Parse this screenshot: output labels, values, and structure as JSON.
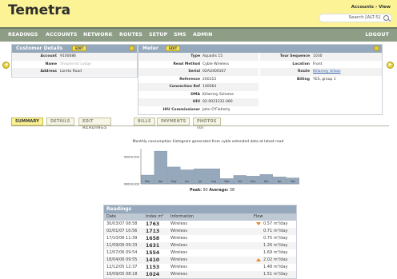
{
  "app": {
    "title": "Temetra",
    "breadcrumb": "Accounts › View",
    "search_placeholder": "Search [ALT-S]"
  },
  "nav": {
    "items": [
      "READINGS",
      "ACCOUNTS",
      "NETWORK",
      "ROUTES",
      "SETUP",
      "SMS",
      "ADMIN"
    ],
    "logout": "LOGOUT"
  },
  "customer": {
    "title": "Customer Details",
    "edit": "EDIT",
    "fields": [
      {
        "label": "Account",
        "value": "9100086"
      },
      {
        "label": "Name",
        "value": "Shepherds Lodge"
      },
      {
        "label": "Address",
        "value": "Loreto Road"
      }
    ]
  },
  "meter": {
    "title": "Meter",
    "edit": "EDIT",
    "fields": [
      {
        "label": "Type",
        "value": "Aquadis 15"
      },
      {
        "label": "Read Method",
        "value": "Cyble Wireless"
      },
      {
        "label": "Serial",
        "value": "02AU400167"
      },
      {
        "label": "Reference",
        "value": "200315"
      },
      {
        "label": "Connection Ref",
        "value": "100064"
      },
      {
        "label": "DMA",
        "value": "Killarney Scheme"
      },
      {
        "label": "HIU",
        "value": "02-0021332-060"
      },
      {
        "label": "HIU Commissioner",
        "value": "John O'Flaherty"
      }
    ],
    "extra": [
      {
        "label": "Tour Sequence",
        "value": "1030"
      },
      {
        "label": "Location",
        "value": "Front"
      },
      {
        "label": "Route",
        "value": "Killarney Urban"
      },
      {
        "label": "Billing",
        "value": "YES, group 1"
      }
    ]
  },
  "tabs": [
    "SUMMARY",
    "DETAILS",
    "EDIT READINGS",
    "BILLS",
    "PAYMENTS",
    "PHOTOS (0)"
  ],
  "chart_caption": "Monthly consumption histogram generated from cyble extended data at latest read",
  "chart_data": {
    "type": "bar",
    "categories": [
      "Mar",
      "Apr",
      "May",
      "Jun",
      "Jul",
      "Aug",
      "Sep",
      "Oct",
      "Nov",
      "Dec",
      "Jan",
      "Feb"
    ],
    "values": [
      25,
      93,
      48,
      40,
      43,
      43,
      15,
      24,
      22,
      27,
      20,
      17
    ],
    "ytick_labels": [
      "00000.000",
      "00000.000"
    ],
    "ylim": [
      0,
      100
    ],
    "grid": false
  },
  "peak": {
    "peak_label": "Peak:",
    "peak_value": "93",
    "avg_label": "Average:",
    "avg_value": "38"
  },
  "readings": {
    "title": "Readings",
    "headers": [
      "Date",
      "Index m³",
      "Information",
      "Flow"
    ],
    "rows": [
      {
        "date": "30/03/07 08:58",
        "index": "1763",
        "info": "Wireless",
        "flow": "0.57 m³/day",
        "trend": "down"
      },
      {
        "date": "02/01/07 10:56",
        "index": "1713",
        "info": "Wireless",
        "flow": "0.71 m³/day",
        "trend": ""
      },
      {
        "date": "17/10/06 11:39",
        "index": "1658",
        "info": "Wireless",
        "flow": "0.75 m³/day",
        "trend": ""
      },
      {
        "date": "11/09/06 09:33",
        "index": "1631",
        "info": "Wireless",
        "flow": "1.26 m³/day",
        "trend": ""
      },
      {
        "date": "12/07/06 09:54",
        "index": "1554",
        "info": "Wireless",
        "flow": "1.69 m³/day",
        "trend": ""
      },
      {
        "date": "18/04/06 09:55",
        "index": "1410",
        "info": "Wireless",
        "flow": "2.02 m³/day",
        "trend": "up"
      },
      {
        "date": "12/12/05 12:37",
        "index": "1153",
        "info": "Wireless",
        "flow": "1.48 m³/day",
        "trend": ""
      },
      {
        "date": "16/09/05 08:18",
        "index": "1024",
        "info": "Wireless",
        "flow": "1.51 m³/day",
        "trend": ""
      }
    ]
  },
  "colors": {
    "accent": "#fbf396",
    "nav": "#8e9d86",
    "panel_head": "#96a8bb",
    "bar": "#96a8bb"
  }
}
